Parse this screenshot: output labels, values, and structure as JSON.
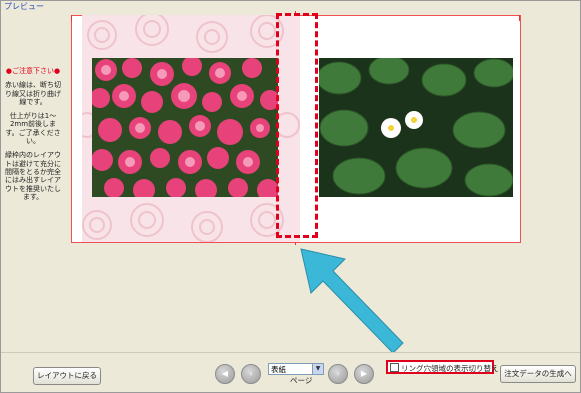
{
  "window": {
    "title": "プレビュー"
  },
  "notice": {
    "title": "●ご注意下さい●",
    "paragraphs": [
      "赤い線は、断ち切り線又は折り曲げ線です。",
      "仕上がりは1〜2mm前後します。ご了承ください。",
      "緑枠内のレイアウトは避けて充分に間隔をとるか完全にはみ出すレイアウトを推奨いたします。"
    ]
  },
  "controls": {
    "back_button": "レイアウトに戻る",
    "page_select": {
      "value": "表紙",
      "label": "ページ"
    },
    "ring_toggle": "リング穴領域の表示切り替え",
    "generate_button": "注文データの生成へ"
  },
  "colors": {
    "accent": "#e0001b",
    "arrow": "#3bb8d8"
  }
}
